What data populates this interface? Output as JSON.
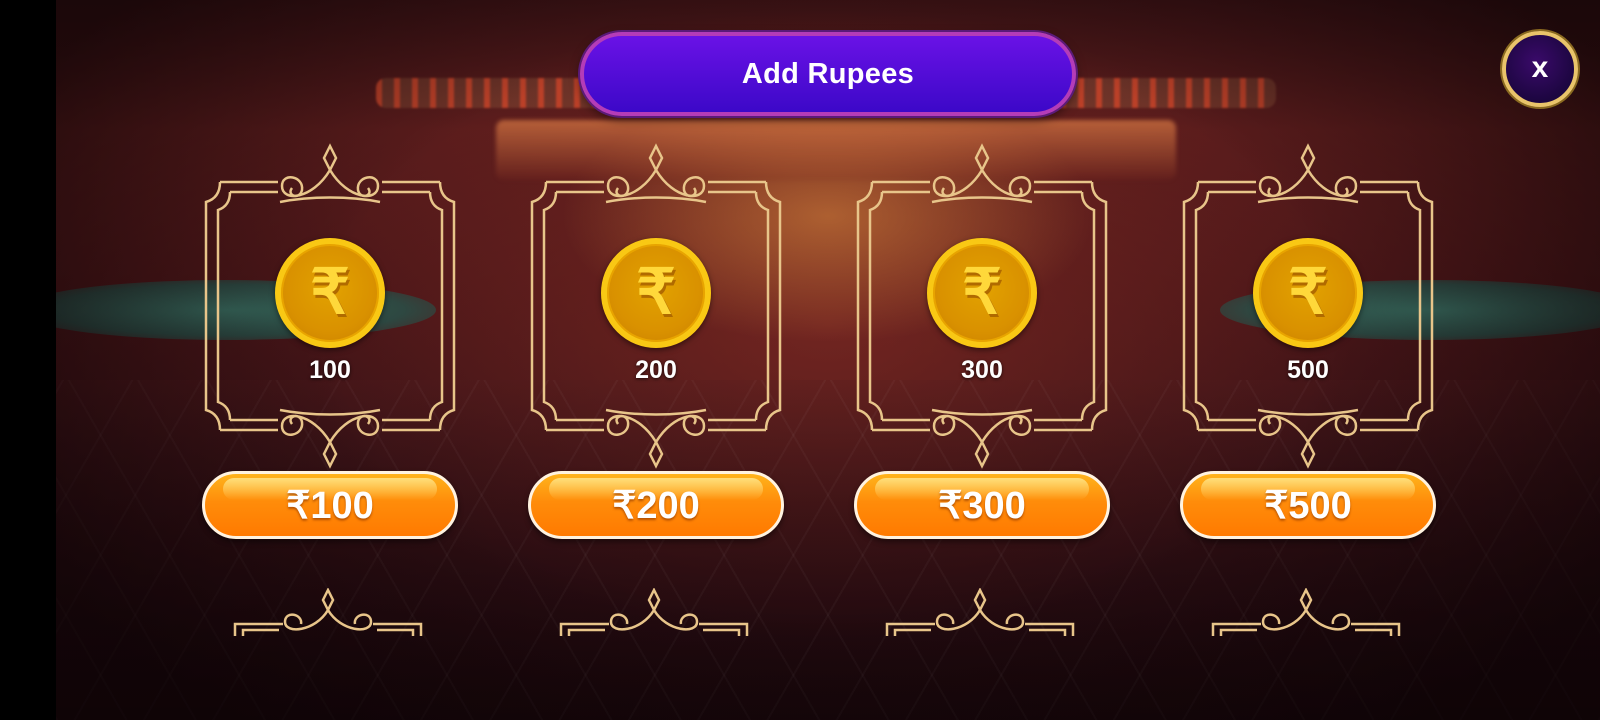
{
  "header": {
    "title": "Add Rupees"
  },
  "close": {
    "label": "x",
    "icon": "close-icon"
  },
  "currency_symbol": "₹",
  "packages": [
    {
      "amount_label": "100",
      "button_label": "₹100"
    },
    {
      "amount_label": "200",
      "button_label": "₹200"
    },
    {
      "amount_label": "300",
      "button_label": "₹300"
    },
    {
      "amount_label": "500",
      "button_label": "₹500"
    }
  ],
  "colors": {
    "title_pill": "#4a0ad6",
    "title_border": "#b43cb8",
    "coin_gold": "#e2a200",
    "button_orange": "#ff8c0a",
    "frame_gold": "#e8c58a"
  }
}
